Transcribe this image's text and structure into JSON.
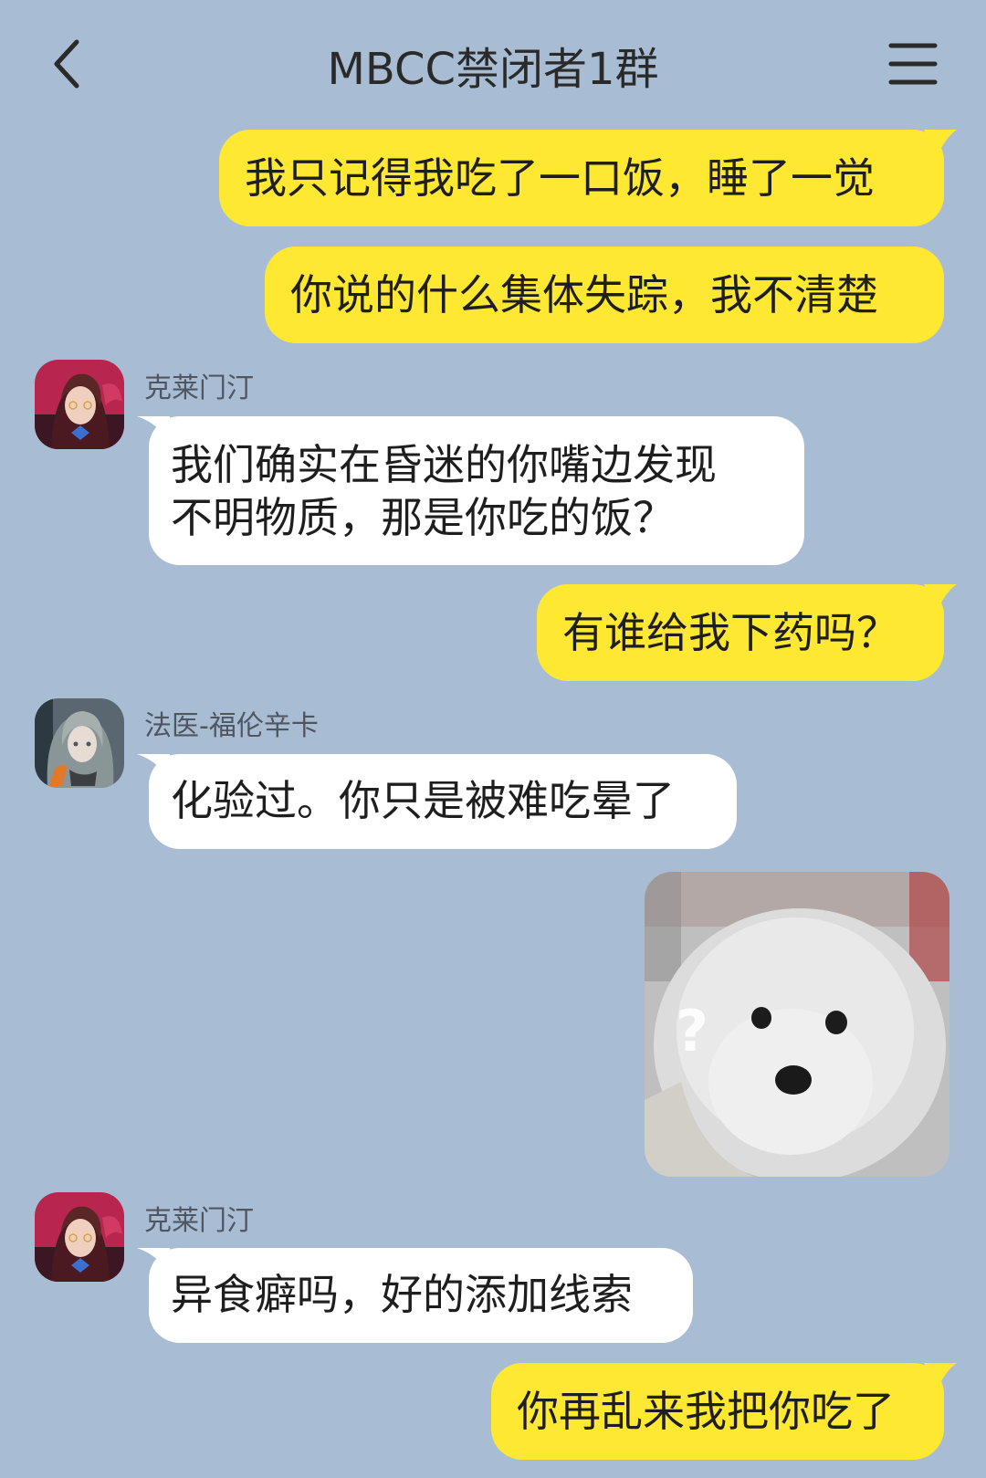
{
  "header": {
    "title": "MBCC禁闭者1群",
    "back_icon": "chevron-left-icon",
    "menu_icon": "hamburger-menu-icon"
  },
  "colors": {
    "background": "#a8bdd3",
    "outgoing_bubble": "#ffe832",
    "incoming_bubble": "#ffffff"
  },
  "messages": [
    {
      "direction": "out",
      "text": "我只记得我吃了一口饭，睡了一觉"
    },
    {
      "direction": "out",
      "text": "你说的什么集体失踪，我不清楚"
    },
    {
      "direction": "in",
      "sender": "克莱门汀",
      "lines": [
        "我们确实在昏迷的你嘴边发现",
        "不明物质，那是你吃的饭？"
      ]
    },
    {
      "direction": "out",
      "text": "有谁给我下药吗？"
    },
    {
      "direction": "in",
      "sender": "法医-福伦辛卡",
      "text": "化验过。你只是被难吃晕了"
    },
    {
      "direction": "out",
      "type": "sticker",
      "sticker": "confused-samoyed-dog",
      "overlay_text": "?"
    },
    {
      "direction": "in",
      "sender": "克莱门汀",
      "text": "异食癖吗，好的添加线索"
    },
    {
      "direction": "out",
      "text": "你再乱来我把你吃了"
    }
  ]
}
